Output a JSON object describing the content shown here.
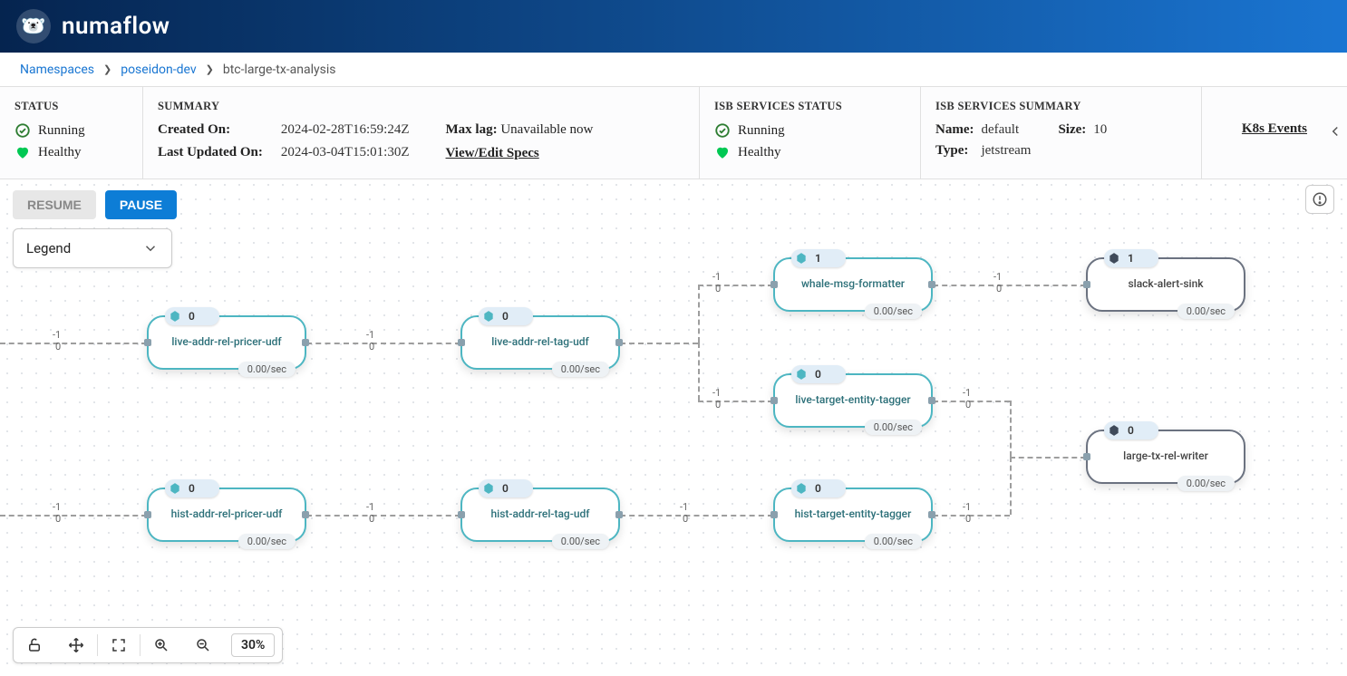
{
  "brand": {
    "name": "numaflow",
    "mascot": "🐻‍❄️"
  },
  "breadcrumb": {
    "root": "Namespaces",
    "namespace": "poseidon-dev",
    "pipeline": "btc-large-tx-analysis"
  },
  "panels": {
    "status": {
      "title": "STATUS",
      "running": "Running",
      "healthy": "Healthy"
    },
    "summary": {
      "title": "SUMMARY",
      "created_label": "Created On:",
      "created_value": "2024-02-28T16:59:24Z",
      "updated_label": "Last Updated On:",
      "updated_value": "2024-03-04T15:01:30Z",
      "maxlag_label": "Max lag:",
      "maxlag_value": "Unavailable now",
      "view_link": "View",
      "edit_link": "Edit Specs"
    },
    "isb_status": {
      "title": "ISB SERVICES STATUS",
      "running": "Running",
      "healthy": "Healthy"
    },
    "isb_summary": {
      "title": "ISB SERVICES SUMMARY",
      "name_label": "Name:",
      "name_value": "default",
      "type_label": "Type:",
      "type_value": "jetstream",
      "size_label": "Size:",
      "size_value": "10"
    },
    "k8s_link": "K8s Events"
  },
  "toolbar": {
    "resume": "RESUME",
    "pause": "PAUSE",
    "legend": "Legend"
  },
  "bottom": {
    "zoom": "30%"
  },
  "edge_default": {
    "top": "-1",
    "bottom": "0"
  },
  "nodes": {
    "n1": {
      "label": "live-addr-rel-pricer-udf",
      "count": "0",
      "rate": "0.00/sec",
      "kind": "udf"
    },
    "n2": {
      "label": "live-addr-rel-tag-udf",
      "count": "0",
      "rate": "0.00/sec",
      "kind": "udf"
    },
    "n3": {
      "label": "whale-msg-formatter",
      "count": "1",
      "rate": "0.00/sec",
      "kind": "udf"
    },
    "n4": {
      "label": "slack-alert-sink",
      "count": "1",
      "rate": "0.00/sec",
      "kind": "sink"
    },
    "n5": {
      "label": "live-target-entity-tagger",
      "count": "0",
      "rate": "0.00/sec",
      "kind": "udf"
    },
    "n6": {
      "label": "hist-addr-rel-pricer-udf",
      "count": "0",
      "rate": "0.00/sec",
      "kind": "udf"
    },
    "n7": {
      "label": "hist-addr-rel-tag-udf",
      "count": "0",
      "rate": "0.00/sec",
      "kind": "udf"
    },
    "n8": {
      "label": "hist-target-entity-tagger",
      "count": "0",
      "rate": "0.00/sec",
      "kind": "udf"
    },
    "n9": {
      "label": "large-tx-rel-writer",
      "count": "0",
      "rate": "0.00/sec",
      "kind": "sink"
    }
  }
}
